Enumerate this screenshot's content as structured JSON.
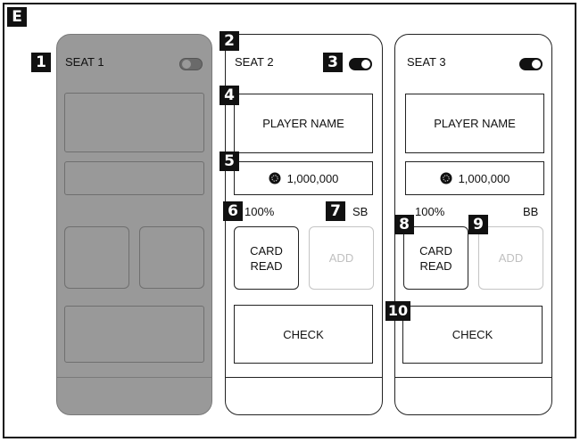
{
  "figure_label": "E",
  "seats": [
    {
      "name": "SEAT 1",
      "badge": "1",
      "toggle": "off",
      "state": "disabled"
    },
    {
      "name": "SEAT 2",
      "badge_panel": "2",
      "badge_toggle": "3",
      "badge_player": "4",
      "badge_chips": "5",
      "badge_percent": "6",
      "badge_position": "7",
      "toggle": "on",
      "player_name": "PLAYER NAME",
      "chip_count": "1,000,000",
      "percent": "100%",
      "position": "SB",
      "card_read_label": "CARD\nREAD",
      "add_label": "ADD",
      "action_label": "CHECK"
    },
    {
      "name": "SEAT 3",
      "badge_card_read": "8",
      "badge_add": "9",
      "badge_action": "10",
      "toggle": "on",
      "player_name": "PLAYER NAME",
      "chip_count": "1,000,000",
      "percent": "100%",
      "position": "BB",
      "card_read_label": "CARD\nREAD",
      "add_label": "ADD",
      "action_label": "CHECK"
    }
  ],
  "colors": {
    "disabled_panel": "#999999",
    "outline": "#222222",
    "ghost_button": "#c4c4c4",
    "badge": "#111111"
  },
  "icons": {
    "chip": "poker-chip-icon",
    "toggle": "toggle-switch-icon"
  }
}
